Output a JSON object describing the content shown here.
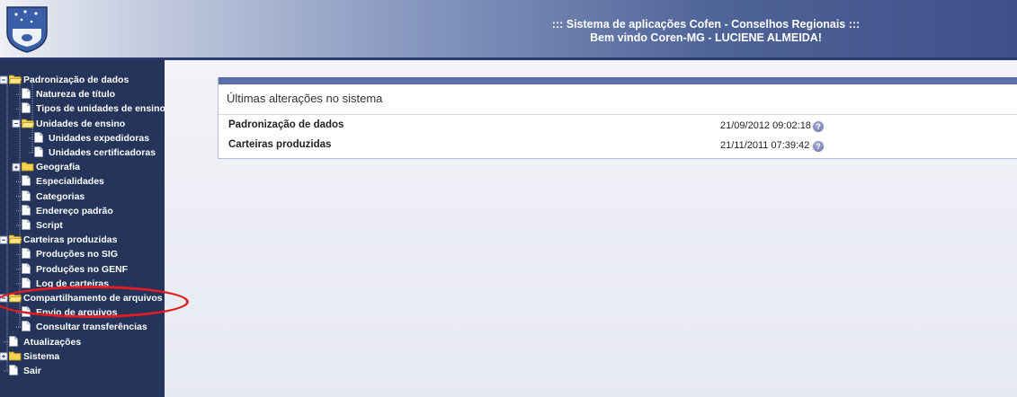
{
  "header": {
    "line1": "::: Sistema de aplicações Cofen - Conselhos Regionais :::",
    "line2": "Bem vindo Coren-MG - LUCIENE ALMEIDA!",
    "logo_icon": "cofen-crest-icon"
  },
  "sidebar": {
    "items": [
      {
        "label": "Padronização de dados",
        "icon": "folder-open-icon",
        "toggle": "minus"
      },
      {
        "label": "Natureza de título",
        "icon": "document-icon"
      },
      {
        "label": "Tipos de unidades de ensino",
        "icon": "document-icon"
      },
      {
        "label": "Unidades de ensino",
        "icon": "folder-open-icon",
        "toggle": "minus"
      },
      {
        "label": "Unidades expedidoras",
        "icon": "document-icon"
      },
      {
        "label": "Unidades certificadoras",
        "icon": "document-icon"
      },
      {
        "label": "Geografia",
        "icon": "folder-icon",
        "toggle": "plus"
      },
      {
        "label": "Especialidades",
        "icon": "document-icon"
      },
      {
        "label": "Categorias",
        "icon": "document-icon"
      },
      {
        "label": "Endereço padrão",
        "icon": "document-icon"
      },
      {
        "label": "Script",
        "icon": "document-icon"
      },
      {
        "label": "Carteiras produzidas",
        "icon": "folder-open-icon",
        "toggle": "minus"
      },
      {
        "label": "Produções no SIG",
        "icon": "document-icon"
      },
      {
        "label": "Produções no GENF",
        "icon": "document-icon"
      },
      {
        "label": "Log de carteiras",
        "icon": "document-icon"
      },
      {
        "label": "Compartilhamento de arquivos",
        "icon": "folder-open-icon",
        "toggle": "minus"
      },
      {
        "label": "Envio de arquivos",
        "icon": "document-icon"
      },
      {
        "label": "Consultar transferências",
        "icon": "document-icon"
      },
      {
        "label": "Atualizações",
        "icon": "document-icon"
      },
      {
        "label": "Sistema",
        "icon": "folder-icon",
        "toggle": "plus"
      },
      {
        "label": "Sair",
        "icon": "document-icon"
      }
    ]
  },
  "main": {
    "panel_title": "Últimas alterações no sistema",
    "rows": [
      {
        "name": "Padronização de dados",
        "date": "21/09/2012 09:02:18",
        "help": "?"
      },
      {
        "name": "Carteiras produzidas",
        "date": "21/11/2011 07:39:42",
        "help": "?"
      }
    ]
  },
  "colors": {
    "sidebar_bg": "#24345a",
    "accent": "#5a6ea8",
    "highlight_circle": "#e51b23"
  }
}
